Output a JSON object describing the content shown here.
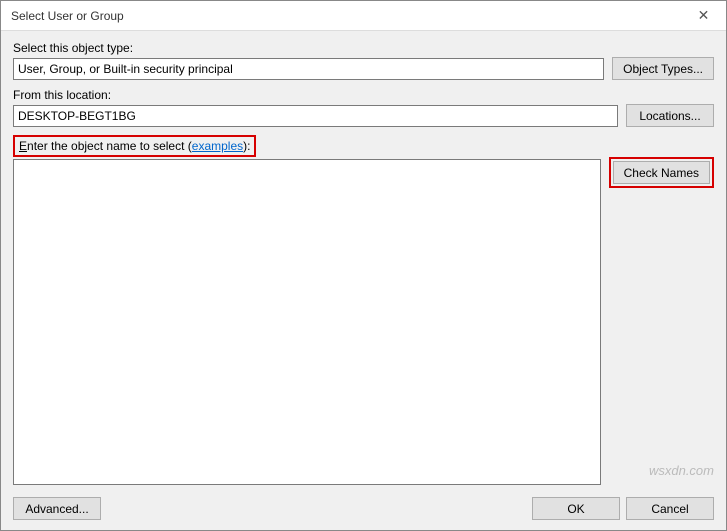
{
  "titlebar": {
    "title": "Select User or Group",
    "close_glyph": "✕"
  },
  "object_type": {
    "label": "Select this object type:",
    "value": "User, Group, or Built-in security principal",
    "button": "Object Types..."
  },
  "location": {
    "label": "From this location:",
    "value": "DESKTOP-BEGT1BG",
    "button": "Locations..."
  },
  "object_name": {
    "label_prefix": "E",
    "label_rest": "nter the object name to select (",
    "examples_text": "examples",
    "label_suffix": "):",
    "value": "",
    "check_names_button": "Check Names"
  },
  "buttons": {
    "advanced": "Advanced...",
    "ok": "OK",
    "cancel": "Cancel"
  },
  "watermark": "wsxdn.com"
}
